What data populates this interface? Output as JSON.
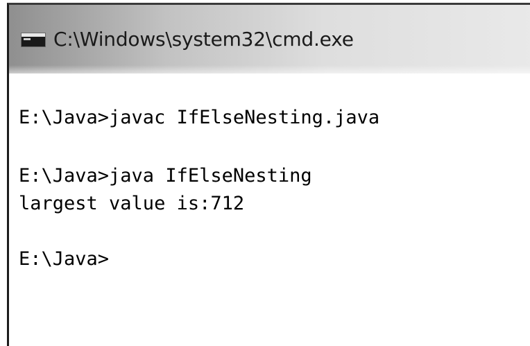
{
  "window": {
    "title": "C:\\Windows\\system32\\cmd.exe",
    "icon": "command-prompt-icon"
  },
  "console": {
    "lines": [
      "E:\\Java>javac IfElseNesting.java",
      "",
      "E:\\Java>java IfElseNesting",
      "largest value is:712",
      "",
      "E:\\Java>"
    ]
  },
  "colors": {
    "background": "#ffffff",
    "text": "#000000",
    "titlebar_dark": "#8f8f8f",
    "titlebar_light": "#e9e9e9"
  }
}
